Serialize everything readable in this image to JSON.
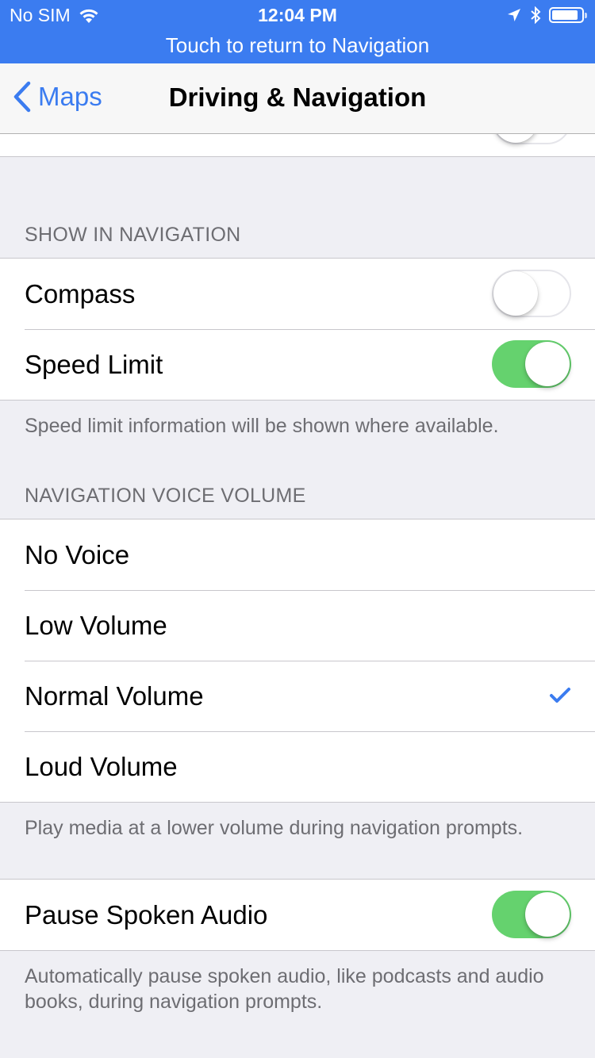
{
  "status_bar": {
    "carrier": "No SIM",
    "time": "12:04 PM",
    "banner": "Touch to return to Navigation",
    "icons": [
      "wifi-icon",
      "location-arrow-icon",
      "bluetooth-icon",
      "battery-icon"
    ]
  },
  "nav": {
    "back_label": "Maps",
    "title": "Driving & Navigation"
  },
  "sections": {
    "show_in_navigation": {
      "header": "Show in Navigation",
      "items": [
        {
          "label": "Compass",
          "on": false
        },
        {
          "label": "Speed Limit",
          "on": true
        }
      ],
      "footer": "Speed limit information will be shown where available."
    },
    "voice_volume": {
      "header": "Navigation Voice Volume",
      "items": [
        {
          "label": "No Voice",
          "selected": false
        },
        {
          "label": "Low Volume",
          "selected": false
        },
        {
          "label": "Normal Volume",
          "selected": true
        },
        {
          "label": "Loud Volume",
          "selected": false
        }
      ],
      "footer": "Play media at a lower volume during navigation prompts."
    },
    "pause_audio": {
      "items": [
        {
          "label": "Pause Spoken Audio",
          "on": true
        }
      ],
      "footer": "Automatically pause spoken audio, like podcasts and audio books, during navigation prompts."
    }
  },
  "colors": {
    "accent": "#3b7cf0",
    "toggle_on": "#65d26e",
    "background": "#efeff4"
  }
}
